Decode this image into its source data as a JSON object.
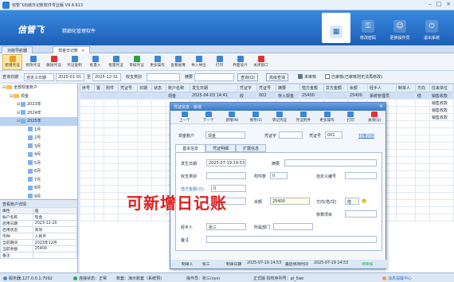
{
  "window": {
    "title": "信管飞出纳日记账软件专业版 V9.4.613"
  },
  "header": {
    "brand": "信管飞",
    "slogan": "精细化管理软件",
    "tools": [
      {
        "label": "",
        "icon": "calendar-icon"
      },
      {
        "label": "修改密码",
        "icon": "key-icon"
      },
      {
        "label": "更换操作员",
        "icon": "user-icon"
      },
      {
        "label": "退出系统",
        "icon": "exit-icon"
      }
    ]
  },
  "tabs": [
    {
      "label": "功能导航器"
    },
    {
      "label": "现金日记账"
    }
  ],
  "toolbar": [
    {
      "label": "新增凭证",
      "color": "#e8a030"
    },
    {
      "label": "修改凭证",
      "color": "#3d86d6"
    },
    {
      "label": "删除凭证",
      "color": "#d33"
    },
    {
      "label": "凭证复制",
      "color": "#3d86d6"
    },
    {
      "label": "批量入",
      "color": "#3d86d6"
    },
    {
      "label": "批量凭证",
      "color": "#3d86d6"
    },
    {
      "label": "审核凭证",
      "color": "#2aa04a"
    },
    {
      "label": "更多操作",
      "color": "#3d86d6"
    },
    {
      "label": "查看账簿",
      "color": "#3d86d6"
    },
    {
      "label": "导入导出",
      "color": "#3d86d6"
    },
    {
      "label": "打印",
      "color": "#3d86d6"
    },
    {
      "label": "界面设计",
      "color": "#3d86d6"
    },
    {
      "label": "关闭窗口",
      "color": "#d33"
    }
  ],
  "filter": {
    "date_label": "查询日期",
    "date_mode": "自定义日期",
    "date_from": "2025-01-01",
    "to": "至",
    "date_to": "2025-12-31",
    "category_label": "收支类别",
    "summary_label": "摘要",
    "query_btn": "查询(Q)",
    "advanced_btn": "高级查询",
    "unaudited": "未审核",
    "audited": "已审核(已审核则无法再修改)"
  },
  "tree": [
    {
      "label": "全部现金账户",
      "level": 0,
      "type": "folder",
      "toggle": "⊟"
    },
    {
      "label": "现金",
      "level": 1,
      "type": "folder",
      "toggle": "⊟"
    },
    {
      "label": "2023年",
      "level": 2,
      "type": "date",
      "toggle": "⊞"
    },
    {
      "label": "2024年",
      "level": 2,
      "type": "date",
      "toggle": "⊞"
    },
    {
      "label": "2025年",
      "level": 2,
      "type": "date",
      "toggle": "⊟",
      "selected": true
    },
    {
      "label": "1月",
      "level": 3,
      "type": "date"
    },
    {
      "label": "2月",
      "level": 3,
      "type": "date"
    },
    {
      "label": "3月",
      "level": 3,
      "type": "date"
    },
    {
      "label": "4月",
      "level": 3,
      "type": "date"
    },
    {
      "label": "5月",
      "level": 3,
      "type": "date"
    },
    {
      "label": "6月",
      "level": 3,
      "type": "date"
    },
    {
      "label": "7月",
      "level": 3,
      "type": "date"
    },
    {
      "label": "8月",
      "level": 3,
      "type": "date"
    },
    {
      "label": "9月",
      "level": 3,
      "type": "date"
    },
    {
      "label": "10月",
      "level": 3,
      "type": "date"
    }
  ],
  "details": {
    "title": "查看账户详情",
    "header": [
      "属性",
      "值"
    ],
    "rows": [
      [
        "账户名称",
        "现金"
      ],
      [
        "启用日期",
        "2023-12-20"
      ],
      [
        "启用状态",
        "有效"
      ],
      [
        "币种",
        "人民币"
      ],
      [
        "当前期间",
        "2023年12月"
      ],
      [
        "当前余额",
        "25400"
      ],
      [
        "备注",
        ""
      ]
    ]
  },
  "grid": {
    "headers": [
      "序号",
      "置",
      "附件",
      "凭证号",
      "日期",
      "状态",
      "账户名称",
      "发生日期",
      "凭证字",
      "凭证号",
      "摘要",
      "借方金额",
      "贷方金额",
      "余额",
      "经手人",
      "制单人",
      "方向",
      "往来单位"
    ],
    "rows": [
      [
        "",
        "",
        "",
        "",
        "",
        "",
        "现金",
        "2025-04-03 14:41",
        "收",
        "002",
        "存入现金",
        "25400",
        "",
        "25400",
        "系统管理员",
        "",
        "借",
        "销售收款"
      ],
      [
        "",
        "",
        "",
        "",
        "",
        "",
        "",
        "",
        "",
        "",
        "",
        "",
        "",
        "",
        "",
        "",
        "",
        "销售收款"
      ],
      [
        "",
        "",
        "",
        "",
        "",
        "",
        "",
        "",
        "",
        "",
        "",
        "",
        "",
        "",
        "",
        "",
        "",
        "销售收款"
      ],
      [
        "",
        "",
        "",
        "",
        "",
        "",
        "",
        "",
        "",
        "",
        "",
        "",
        "",
        "",
        "",
        "",
        "",
        "销售收款"
      ]
    ]
  },
  "dialog": {
    "title": "凭证信息 - 新增",
    "tools": [
      "上一个",
      "下一个",
      "新增(N)",
      "保存(S)",
      "转记凭证",
      "凭证附件",
      "更多操作",
      "打印",
      "关闭(Q)"
    ],
    "account_label": "现金账户",
    "account_value": "现金",
    "voucher_word_label": "凭证字",
    "voucher_no_label": "凭证号",
    "voucher_no": "001",
    "recognize": "扫描识别",
    "tabs": [
      "基本信息",
      "凭证明细",
      "扩展信息"
    ],
    "fields": {
      "occur_date_label": "发生日期",
      "occur_date": "2025-07-19 14:53",
      "summary_label": "摘要",
      "category_label": "收支类别",
      "attach_label": "附件数",
      "attach": "0",
      "custom_no_label": "自定义编号",
      "currency_label": "借方金额(元)",
      "currency_value": "0",
      "balance_label": "余额",
      "balance": "25400",
      "direction_label": "方向(借/贷)",
      "direction": "借",
      "verify_label": "核算项目",
      "handler_label": "经手人",
      "handler": "张三",
      "dept_label": "所属部门",
      "remark_label": "备注"
    },
    "footer": {
      "maker_label": "制单人",
      "maker": "张三",
      "made_label": "制单日期",
      "made": "2025-07-19 14:53",
      "modified_label": "最后修改时间",
      "modified": "2025-07-19 14:53",
      "status": "待审核"
    }
  },
  "overlay_text": "可新增日记账",
  "statusbar": {
    "server": "服务器:127.0.0.1:7092",
    "connection": "连接状态：正常",
    "account": "账套：演示账套（系统预)",
    "operator": "操作员：张三(sys)",
    "license": "正式版 授权序列号：pl_5wc",
    "news": "消息提醒中心"
  }
}
